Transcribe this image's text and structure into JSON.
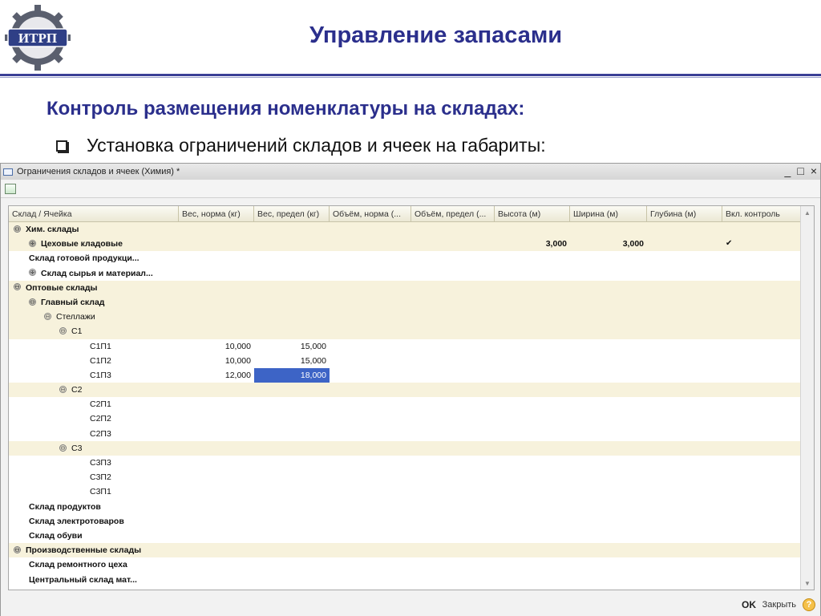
{
  "slide": {
    "logo_text": "ИТРП",
    "title": "Управление запасами",
    "subtitle": "Контроль размещения номенклатуры на складах:",
    "bullet": "Установка ограничений складов и ячеек на габариты:"
  },
  "window": {
    "title": "Ограничения складов и ячеек (Химия) *",
    "controls": {
      "minimize": "_",
      "maximize": "□",
      "close": "×"
    }
  },
  "grid": {
    "columns": [
      "Склад / Ячейка",
      "Вес, норма (кг)",
      "Вес, предел (кг)",
      "Объём, норма (...",
      "Объём, предел (...",
      "Высота (м)",
      "Ширина (м)",
      "Глубина (м)",
      "Вкл. контроль"
    ],
    "rows": [
      {
        "name": "Хим. склады",
        "toggle": "⊖",
        "indent": 0,
        "bold": true,
        "bg": true,
        "ves_norma": "",
        "ves_predel": "",
        "vysota": "",
        "shirina": "",
        "control": ""
      },
      {
        "name": "Цеховые кладовые",
        "toggle": "⊕",
        "indent": 1,
        "bold": true,
        "bg": true,
        "ves_norma": "",
        "ves_predel": "",
        "vysota": "3,000",
        "shirina": "3,000",
        "control": "✔"
      },
      {
        "name": "Склад готовой продукци...",
        "toggle": "",
        "indent": 1,
        "bold": true,
        "bg": false,
        "ves_norma": "",
        "ves_predel": "",
        "vysota": "",
        "shirina": "",
        "control": ""
      },
      {
        "name": "Склад сырья и материал...",
        "toggle": "⊕",
        "indent": 1,
        "bold": true,
        "bg": false,
        "ves_norma": "",
        "ves_predel": "",
        "vysota": "",
        "shirina": "",
        "control": ""
      },
      {
        "name": "Оптовые склады",
        "toggle": "⊖",
        "indent": 0,
        "bold": true,
        "bg": true,
        "ves_norma": "",
        "ves_predel": "",
        "vysota": "",
        "shirina": "",
        "control": ""
      },
      {
        "name": "Главный склад",
        "toggle": "⊖",
        "indent": 1,
        "bold": true,
        "bg": true,
        "ves_norma": "",
        "ves_predel": "",
        "vysota": "",
        "shirina": "",
        "control": ""
      },
      {
        "name": "Стеллажи",
        "toggle": "⊖",
        "indent": 2,
        "bold": false,
        "bg": true,
        "ves_norma": "",
        "ves_predel": "",
        "vysota": "",
        "shirina": "",
        "control": ""
      },
      {
        "name": "С1",
        "toggle": "⊖",
        "indent": 3,
        "bold": false,
        "bg": true,
        "ves_norma": "",
        "ves_predel": "",
        "vysota": "",
        "shirina": "",
        "control": ""
      },
      {
        "name": "С1П1",
        "toggle": "",
        "indent": 5,
        "bold": false,
        "bg": false,
        "ves_norma": "10,000",
        "ves_predel": "15,000",
        "vysota": "",
        "shirina": "",
        "control": ""
      },
      {
        "name": "С1П2",
        "toggle": "",
        "indent": 5,
        "bold": false,
        "bg": false,
        "ves_norma": "10,000",
        "ves_predel": "15,000",
        "vysota": "",
        "shirina": "",
        "control": ""
      },
      {
        "name": "С1П3",
        "toggle": "",
        "indent": 5,
        "bold": false,
        "bg": false,
        "ves_norma": "12,000",
        "ves_predel": "18,000",
        "selected": true,
        "vysota": "",
        "shirina": "",
        "control": ""
      },
      {
        "name": "С2",
        "toggle": "⊖",
        "indent": 3,
        "bold": false,
        "bg": true,
        "ves_norma": "",
        "ves_predel": "",
        "vysota": "",
        "shirina": "",
        "control": ""
      },
      {
        "name": "С2П1",
        "toggle": "",
        "indent": 5,
        "bold": false,
        "bg": false,
        "ves_norma": "",
        "ves_predel": "",
        "vysota": "",
        "shirina": "",
        "control": ""
      },
      {
        "name": "С2П2",
        "toggle": "",
        "indent": 5,
        "bold": false,
        "bg": false,
        "ves_norma": "",
        "ves_predel": "",
        "vysota": "",
        "shirina": "",
        "control": ""
      },
      {
        "name": "С2П3",
        "toggle": "",
        "indent": 5,
        "bold": false,
        "bg": false,
        "ves_norma": "",
        "ves_predel": "",
        "vysota": "",
        "shirina": "",
        "control": ""
      },
      {
        "name": "С3",
        "toggle": "⊖",
        "indent": 3,
        "bold": false,
        "bg": true,
        "ves_norma": "",
        "ves_predel": "",
        "vysota": "",
        "shirina": "",
        "control": ""
      },
      {
        "name": "С3П3",
        "toggle": "",
        "indent": 5,
        "bold": false,
        "bg": false,
        "ves_norma": "",
        "ves_predel": "",
        "vysota": "",
        "shirina": "",
        "control": ""
      },
      {
        "name": "С3П2",
        "toggle": "",
        "indent": 5,
        "bold": false,
        "bg": false,
        "ves_norma": "",
        "ves_predel": "",
        "vysota": "",
        "shirina": "",
        "control": ""
      },
      {
        "name": "С3П1",
        "toggle": "",
        "indent": 5,
        "bold": false,
        "bg": false,
        "ves_norma": "",
        "ves_predel": "",
        "vysota": "",
        "shirina": "",
        "control": ""
      },
      {
        "name": "Склад продуктов",
        "toggle": "",
        "indent": 1,
        "bold": true,
        "bg": false,
        "ves_norma": "",
        "ves_predel": "",
        "vysota": "",
        "shirina": "",
        "control": ""
      },
      {
        "name": "Склад электротоваров",
        "toggle": "",
        "indent": 1,
        "bold": true,
        "bg": false,
        "ves_norma": "",
        "ves_predel": "",
        "vysota": "",
        "shirina": "",
        "control": ""
      },
      {
        "name": "Склад обуви",
        "toggle": "",
        "indent": 1,
        "bold": true,
        "bg": false,
        "ves_norma": "",
        "ves_predel": "",
        "vysota": "",
        "shirina": "",
        "control": ""
      },
      {
        "name": "Производственные склады",
        "toggle": "⊖",
        "indent": 0,
        "bold": true,
        "bg": true,
        "ves_norma": "",
        "ves_predel": "",
        "vysota": "",
        "shirina": "",
        "control": ""
      },
      {
        "name": "Склад ремонтного цеха",
        "toggle": "",
        "indent": 1,
        "bold": true,
        "bg": false,
        "ves_norma": "",
        "ves_predel": "",
        "vysota": "",
        "shirina": "",
        "control": ""
      },
      {
        "name": "Центральный склад мат...",
        "toggle": "",
        "indent": 1,
        "bold": true,
        "bg": false,
        "ves_norma": "",
        "ves_predel": "",
        "vysota": "",
        "shirina": "",
        "control": ""
      }
    ]
  },
  "footer": {
    "ok_label": "OK",
    "close_label": "Закрыть",
    "help_label": "?"
  }
}
